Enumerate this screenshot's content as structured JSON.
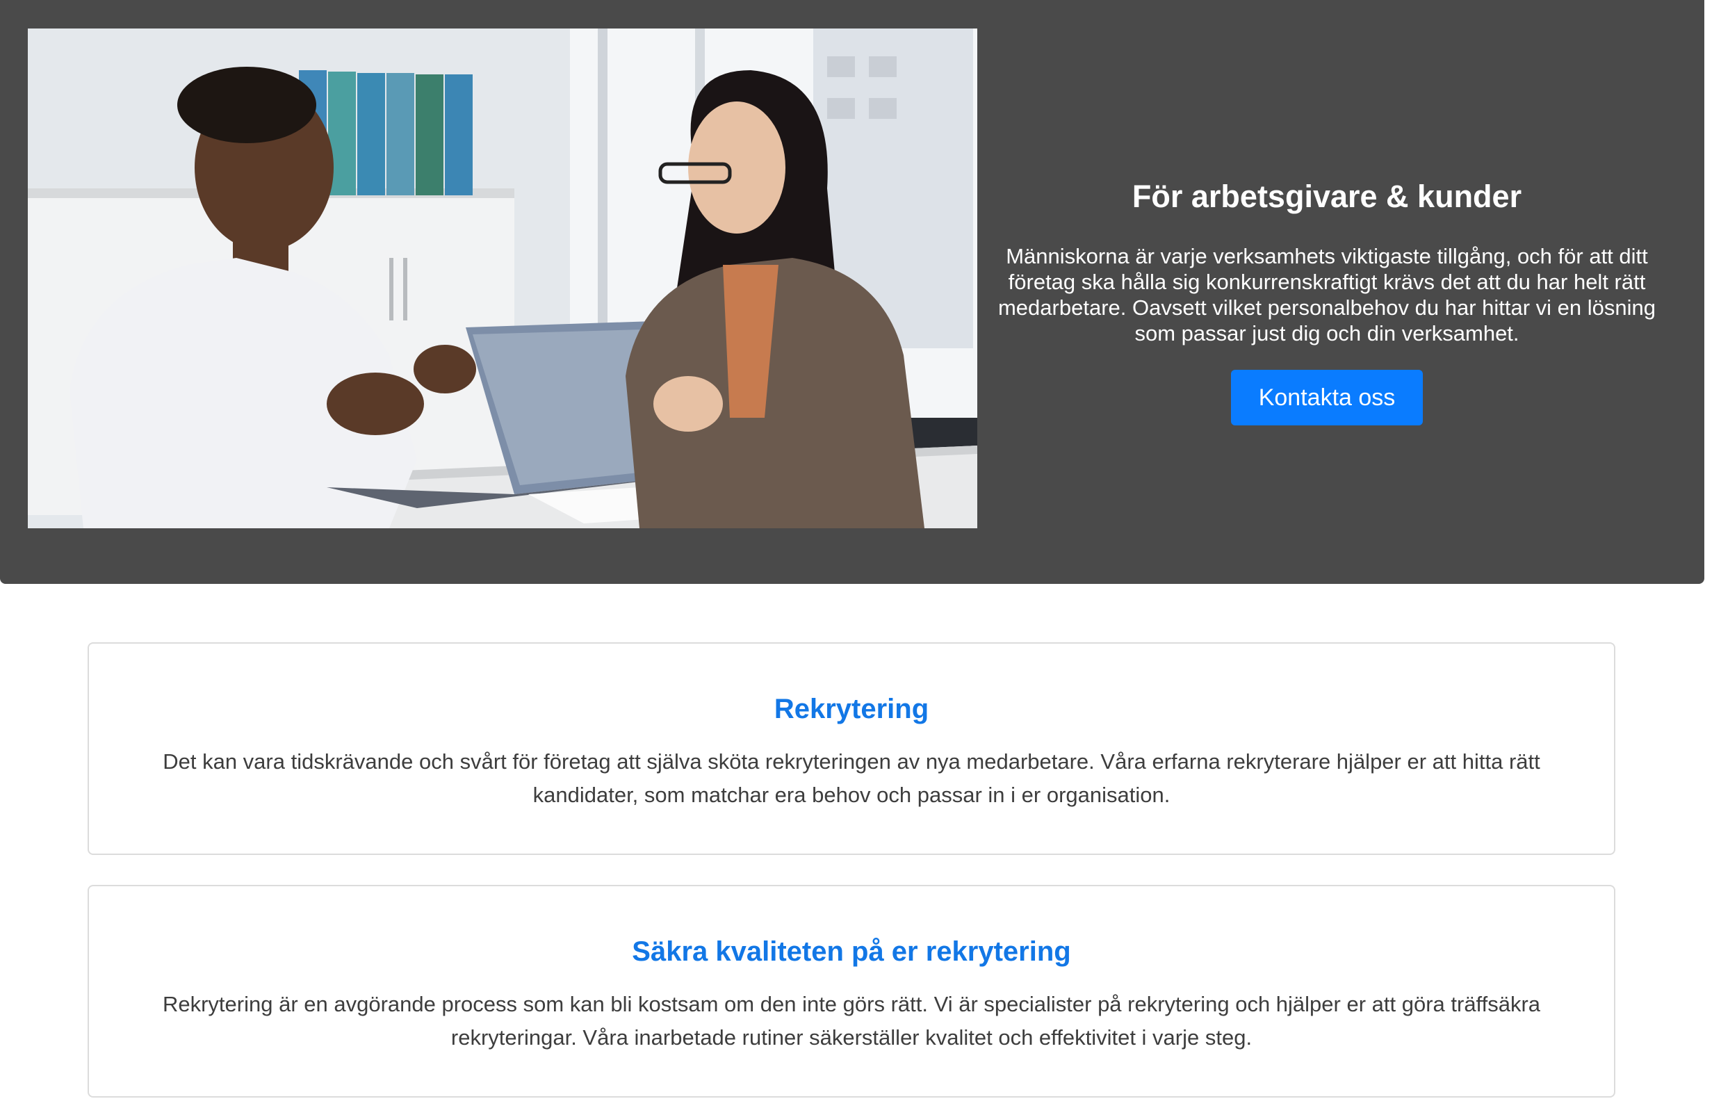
{
  "hero": {
    "title": "För arbetsgivare & kunder",
    "body": "Människorna är varje verksamhets viktigaste tillgång, och för att ditt företag ska hålla sig konkurrenskraftigt krävs det att du har helt rätt medarbetare. Oavsett vilket personalbehov du har hittar vi en lösning som passar just dig och din verksamhet.",
    "button_label": "Kontakta oss",
    "background_color": "#4a4a4a",
    "button_color": "#0a7cff"
  },
  "cards": [
    {
      "title": "Rekrytering",
      "body": "Det kan vara tidskrävande och svårt för företag att själva sköta rekryteringen av nya medarbetare. Våra erfarna rekryterare hjälper er att hitta rätt kandidater, som matchar era behov och passar in i er organisation."
    },
    {
      "title": "Säkra kvaliteten på er rekrytering",
      "body": "Rekrytering är en avgörande process som kan bli kostsam om den inte görs rätt. Vi är specialister på rekrytering och hjälper er att göra träffsäkra rekryteringar. Våra inarbetade rutiner säkerställer kvalitet och effektivitet i varje steg."
    }
  ],
  "colors": {
    "card_title": "#1277e6",
    "card_text": "#3d3d3d",
    "card_border": "#dcdcdc"
  }
}
